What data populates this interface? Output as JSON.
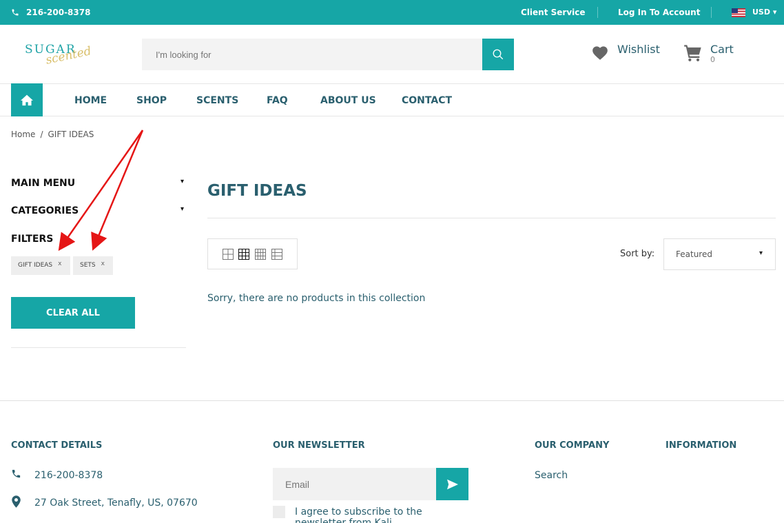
{
  "topbar": {
    "phone": "216-200-8378",
    "client_service": "Client Service",
    "login": "Log In To Account",
    "currency": "USD ▾"
  },
  "brand": {
    "logo_line1": "SUGAR",
    "logo_line2": "scented",
    "accent_color": "#16a6a6",
    "text_color": "#2a5f6e"
  },
  "header": {
    "search_placeholder": "I'm looking for",
    "wishlist_label": "Wishlist",
    "cart_label": "Cart",
    "cart_count": "0"
  },
  "nav": {
    "items": [
      "HOME",
      "SHOP",
      "SCENTS",
      "FAQ",
      "ABOUT US",
      "CONTACT"
    ]
  },
  "breadcrumb": {
    "home": "Home",
    "separator": "/",
    "current": "GIFT IDEAS"
  },
  "sidebar": {
    "main_menu": "MAIN MENU",
    "categories": "CATEGORIES",
    "filters": "FILTERS",
    "tags": [
      {
        "label": "GIFT IDEAS",
        "remove": "x"
      },
      {
        "label": "SETS",
        "remove": "x"
      }
    ],
    "clear_all": "CLEAR ALL"
  },
  "main": {
    "title": "GIFT IDEAS",
    "sort_label": "Sort by:",
    "sort_value": "Featured",
    "empty_message": "Sorry, there are no products in this collection"
  },
  "footer": {
    "contact_heading": "CONTACT DETAILS",
    "phone": "216-200-8378",
    "address": "27 Oak Street, Tenafly, US, 07670",
    "newsletter_heading": "OUR NEWSLETTER",
    "email_placeholder": "Email",
    "agree_text": "I agree to subscribe to the newsletter from Kali",
    "company_heading": "OUR COMPANY",
    "company_link": "Search",
    "info_heading": "INFORMATION"
  }
}
